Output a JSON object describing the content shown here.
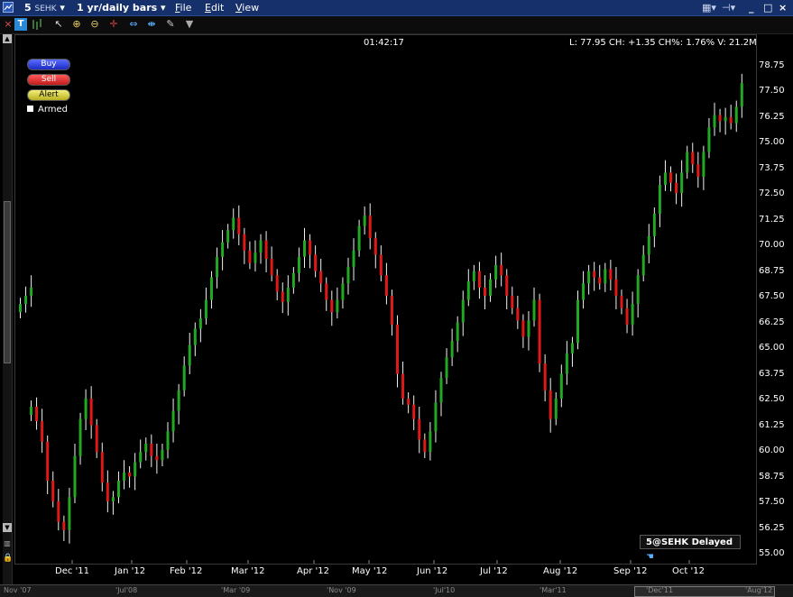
{
  "titlebar": {
    "symbol": "5",
    "exchange": "SEHK",
    "period": "1 yr/daily bars",
    "menus": [
      {
        "key": "F",
        "rest": "ile"
      },
      {
        "key": "E",
        "rest": "dit"
      },
      {
        "key": "V",
        "rest": "iew"
      }
    ]
  },
  "orders": {
    "buy": "Buy",
    "sell": "Sell",
    "alert": "Alert",
    "armed": "Armed"
  },
  "header": {
    "clock": "01:42:17",
    "quote": "L: 77.95 CH: +1.35 CH%: 1.76% V: 21.2M"
  },
  "badge": "5@SEHK Delayed",
  "colors": {
    "up": "#22a822",
    "down": "#e01818",
    "background": "#000000",
    "titlebar": "#15306a"
  },
  "nav": {
    "labels": [
      "Nov '07",
      "'Jul'08",
      "'Mar '09",
      "'Nov '09",
      "'Jul'10",
      "'Mar'11",
      "'Dec'11",
      "'Aug'12"
    ]
  },
  "chart_data": {
    "type": "candlestick",
    "y_tick_labels": [
      "78.75",
      "77.50",
      "76.25",
      "75.00",
      "73.75",
      "72.50",
      "71.25",
      "70.00",
      "68.75",
      "67.50",
      "66.25",
      "65.00",
      "63.75",
      "62.50",
      "61.25",
      "60.00",
      "58.75",
      "57.50",
      "56.25",
      "55.00"
    ],
    "ylim": [
      55.0,
      78.75
    ],
    "x_tick_labels": [
      "Dec '11",
      "Jan '12",
      "Feb '12",
      "Mar '12",
      "Apr '12",
      "May '12",
      "Jun '12",
      "Jul '12",
      "Aug '12",
      "Sep '12",
      "Oct '12"
    ],
    "series": [
      {
        "close": [
          67.2,
          67.6,
          68.0
        ]
      },
      {
        "close": [
          62.2,
          61.5,
          60.5,
          58.6,
          57.6,
          56.6,
          56.2,
          57.8,
          59.8,
          61.6,
          62.6,
          61.3,
          60.0,
          58.5,
          57.6,
          57.8,
          58.6,
          59.0,
          58.8,
          59.5,
          60.0,
          60.4,
          59.8,
          59.6,
          60.1,
          61.0,
          62.0,
          63.0,
          64.2,
          65.2,
          66.0,
          66.5,
          67.4,
          68.5,
          69.5,
          70.2,
          70.8,
          71.4,
          70.6,
          69.8,
          69.2,
          69.7,
          70.3,
          69.4,
          68.6,
          67.8,
          67.3,
          68.0,
          68.7,
          69.5,
          70.3,
          69.6,
          68.8,
          68.2,
          67.4,
          66.8,
          67.4,
          68.2,
          69.0,
          69.8,
          71.0,
          71.5,
          70.4,
          69.6,
          68.6,
          67.6,
          66.2,
          63.8,
          62.6,
          62.3,
          61.6,
          60.6,
          60.0,
          61.0,
          62.4,
          63.6,
          64.6,
          65.4,
          66.3,
          67.4,
          68.3,
          68.8,
          68.0,
          67.6,
          68.4,
          69.1,
          68.6,
          67.6,
          67.0,
          66.4,
          65.6,
          66.4,
          67.4,
          64.3,
          63.0,
          61.6,
          62.6,
          63.8,
          64.8,
          65.3,
          67.4,
          68.2,
          68.8,
          68.5,
          68.2,
          68.9,
          68.4,
          67.6,
          67.0,
          66.2,
          67.2,
          68.6,
          69.6,
          70.5,
          71.6,
          73.0,
          73.6,
          73.1,
          72.6,
          73.6,
          74.6,
          74.0,
          73.4,
          74.6,
          75.8,
          76.4,
          76.1,
          76.3,
          76.0,
          76.8,
          77.95
        ]
      }
    ]
  }
}
